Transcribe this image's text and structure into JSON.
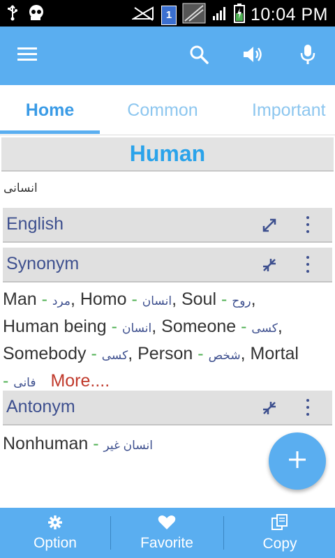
{
  "status_bar": {
    "time": "10:04 PM",
    "sim_slot": "1",
    "icons": [
      "usb-icon",
      "voicemail-icon",
      "no-signal-icon",
      "sim-icon",
      "picture-icon",
      "signal-icon",
      "battery-charging-icon"
    ]
  },
  "app_bar": {
    "icons": [
      "menu-icon",
      "search-icon",
      "speaker-icon",
      "microphone-icon"
    ]
  },
  "tabs": [
    {
      "label": "Home",
      "active": true
    },
    {
      "label": "Common",
      "active": false
    },
    {
      "label": "Important",
      "active": false
    }
  ],
  "word": "Human",
  "translation": "انسانی",
  "sections": {
    "english": {
      "title": "English",
      "state": "collapsed"
    },
    "synonym": {
      "title": "Synonym",
      "state": "expanded"
    },
    "antonym": {
      "title": "Antonym",
      "state": "expanded"
    }
  },
  "synonyms": [
    {
      "en": "Man",
      "fa": "مرد"
    },
    {
      "en": "Homo",
      "fa": "انسان"
    },
    {
      "en": "Soul",
      "fa": "روح"
    },
    {
      "en": "Human being",
      "fa": "انسان"
    },
    {
      "en": "Someone",
      "fa": "کسی"
    },
    {
      "en": "Somebody",
      "fa": "کسی"
    },
    {
      "en": "Person",
      "fa": "شخص"
    },
    {
      "en": "Mortal",
      "fa": "فانی"
    }
  ],
  "synonym_more": "More....",
  "antonyms": [
    {
      "en": "Nonhuman",
      "fa": "انسان غیر"
    }
  ],
  "fab_icon": "plus-icon",
  "bottom_nav": [
    {
      "label": "Option",
      "icon": "gear-icon"
    },
    {
      "label": "Favorite",
      "icon": "heart-icon"
    },
    {
      "label": "Copy",
      "icon": "copy-icon"
    }
  ],
  "colors": {
    "primary": "#5aaef0",
    "word": "#2aa3ea",
    "section_title": "#3d4f8e",
    "dash": "#4caf50",
    "more_link": "#c0392b"
  }
}
